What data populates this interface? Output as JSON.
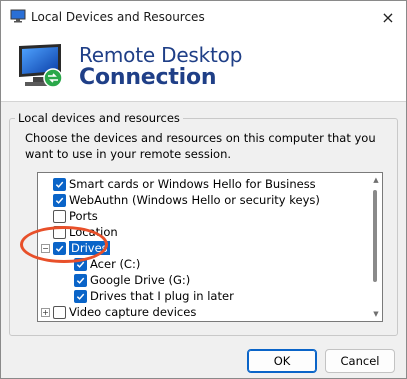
{
  "window": {
    "title": "Local Devices and Resources",
    "close_icon": "×"
  },
  "banner": {
    "line1": "Remote Desktop",
    "line2": "Connection"
  },
  "group": {
    "legend": "Local devices and resources",
    "description": "Choose the devices and resources on this computer that you want to use in your remote session."
  },
  "tree": {
    "items": [
      {
        "label": "Smart cards or Windows Hello for Business",
        "checked": true
      },
      {
        "label": "WebAuthn (Windows Hello or security keys)",
        "checked": true
      },
      {
        "label": "Ports",
        "checked": false
      },
      {
        "label": "Location",
        "checked": false
      },
      {
        "label": "Drives",
        "checked": true,
        "expanded": true,
        "selected": true,
        "expander": "−"
      },
      {
        "label": "Acer (C:)",
        "checked": true
      },
      {
        "label": "Google Drive (G:)",
        "checked": true
      },
      {
        "label": "Drives that I plug in later",
        "checked": true
      },
      {
        "label": "Video capture devices",
        "checked": false,
        "expander": "+"
      }
    ]
  },
  "buttons": {
    "ok": "OK",
    "cancel": "Cancel"
  },
  "colors": {
    "accent": "#0a64c8",
    "banner_text": "#1f3f87",
    "highlight": "#e8502a"
  }
}
